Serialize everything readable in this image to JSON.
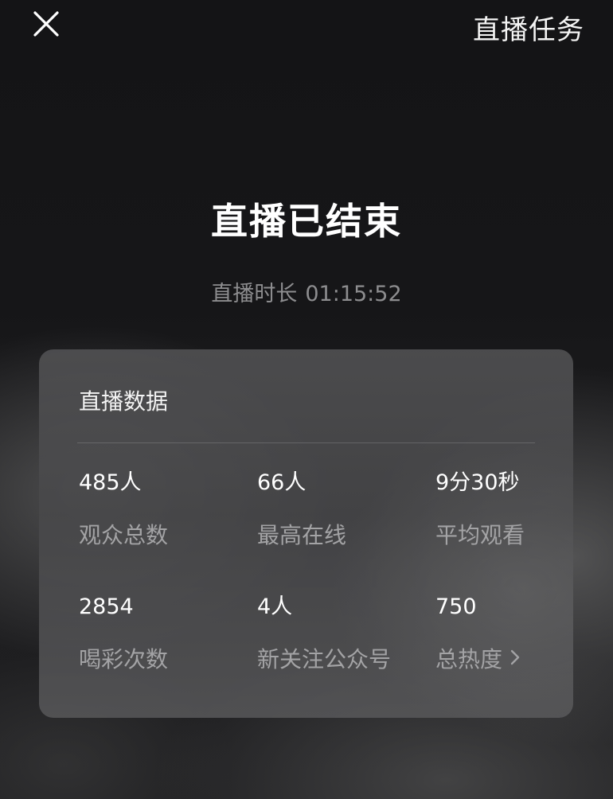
{
  "header": {
    "close_icon": "close-icon",
    "task_label": "直播任务"
  },
  "main": {
    "title": "直播已结束",
    "duration_label": "直播时长",
    "duration_value": "01:15:52"
  },
  "stats_card": {
    "title": "直播数据",
    "stats": [
      {
        "value": "485人",
        "label": "观众总数"
      },
      {
        "value": "66人",
        "label": "最高在线"
      },
      {
        "value": "9分30秒",
        "label": "平均观看"
      },
      {
        "value": "2854",
        "label": "喝彩次数"
      },
      {
        "value": "4人",
        "label": "新关注公众号"
      },
      {
        "value": "750",
        "label": "总热度",
        "icon": "chevron-right-icon"
      }
    ]
  },
  "colors": {
    "background": "#161618",
    "card": "#505052",
    "text_primary": "#ffffff",
    "text_secondary": "#a3a3a5"
  }
}
